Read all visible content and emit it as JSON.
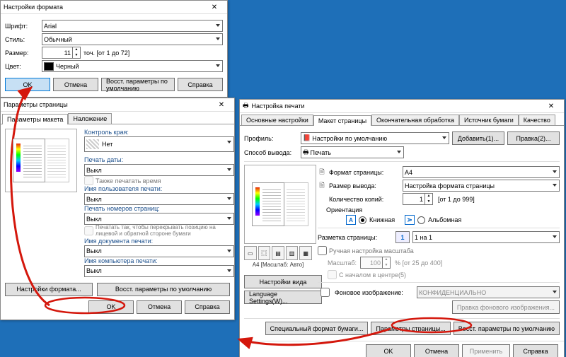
{
  "fmt": {
    "title": "Настройки формата",
    "font_lbl": "Шрифт:",
    "font_val": "Arial",
    "style_lbl": "Стиль:",
    "style_val": "Обычный",
    "size_lbl": "Размер:",
    "size_val": "11",
    "size_hint": "точ. [от 1 до 72]",
    "color_lbl": "Цвет:",
    "color_val": "Черный",
    "ok": "OK",
    "cancel": "Отмена",
    "restore": "Восст. параметры по умолчанию",
    "help": "Справка"
  },
  "pg": {
    "title": "Параметры страницы",
    "tab_layout": "Параметры макета",
    "tab_overlay": "Наложение",
    "edge_lbl": "Контроль края:",
    "edge_val": "Нет",
    "printdate_lbl": "Печать даты:",
    "printtime_chk": "Также печатать время",
    "user_lbl": "Имя пользователя печати:",
    "pagenum_lbl": "Печать номеров страниц:",
    "overlap_chk": "Печатать так, чтобы перекрывать позицию на лицевой и обратной стороне бумаги",
    "docname_lbl": "Имя документа печати:",
    "compname_lbl": "Имя компьютера печати:",
    "off": "Выкл",
    "format_settings": "Настройки формата...",
    "restore": "Восст. параметры по умолчанию",
    "ok": "OK",
    "cancel": "Отмена",
    "help": "Справка"
  },
  "pr": {
    "icon": "🖶",
    "title": "Настройка печати",
    "tab_main": "Основные настройки",
    "tab_page": "Макет страницы",
    "tab_finish": "Окончательная обработка",
    "tab_source": "Источник бумаги",
    "tab_quality": "Качество",
    "profile_lbl": "Профиль:",
    "profile_val": "Настройки по умолчанию",
    "add": "Добавить(1)...",
    "edit": "Правка(2)...",
    "output_lbl": "Способ вывода:",
    "output_val": "Печать",
    "pagefmt_lbl": "Формат страницы:",
    "pagefmt_val": "A4",
    "outsize_lbl": "Размер вывода:",
    "outsize_val": "Настройка формата страницы",
    "copies_lbl": "Количество копий:",
    "copies_val": "1",
    "copies_hint": "[от 1 до 999]",
    "orient_lbl": "Ориентация",
    "orient_port": "Книжная",
    "orient_land": "Альбомная",
    "layout_lbl": "Разметка страницы:",
    "layout_icon_val": "1",
    "layout_val": "1 на 1",
    "manual_chk": "Ручная настройка масштаба",
    "scale_lbl": "Масштаб:",
    "scale_val": "100",
    "scale_hint": "% [от 25 до 400]",
    "center_chk": "С началом в центре(5)",
    "watermark_chk": "Фоновое изображение:",
    "watermark_val": "КОНФИДЕНЦИАЛЬНО",
    "watermark_edit": "Правка фонового изображения...",
    "preview_caption": "A4 [Масштаб: Авто]",
    "view_settings": "Настройки вида",
    "lang_settings": "Language Settings(W)...",
    "special_fmt": "Специальный формат бумаги...",
    "page_params": "Параметры страницы...",
    "restore": "Восст. параметры по умолчанию",
    "ok": "OK",
    "cancel": "Отмена",
    "apply": "Применить",
    "help": "Справка"
  }
}
